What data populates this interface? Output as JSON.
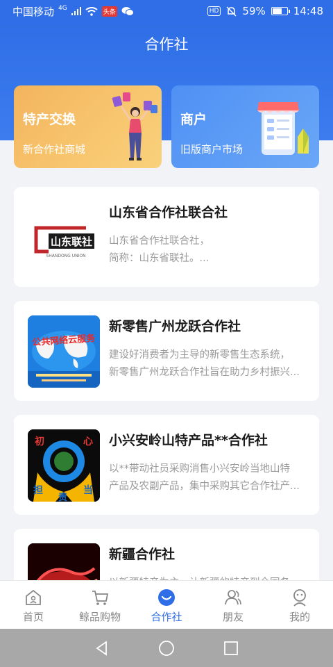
{
  "status_bar": {
    "carrier": "中国移动",
    "network": "4G",
    "badge": "头条",
    "battery": "59%",
    "battery_level": 0.59,
    "time": "14:48"
  },
  "header": {
    "title": "合作社"
  },
  "promo_cards": [
    {
      "title": "特产交换",
      "subtitle": "新合作社商城"
    },
    {
      "title": "商户",
      "subtitle": "旧版商户市场"
    }
  ],
  "coops": [
    {
      "name": "山东省合作社联合社",
      "desc": [
        "山东省合作社联合社，",
        "简称：山东省联社。..."
      ],
      "logo_text": "山东联社",
      "logo_sub": "SHANDONG UNION"
    },
    {
      "name": "新零售广州龙跃合作社",
      "desc": [
        "建设好消费者为主导的新零售生态系统，",
        "新零售广州龙跃合作社旨在助力乡村振兴..."
      ],
      "logo_text": "公共网络云服务"
    },
    {
      "name": "小兴安岭山特产品**合作社",
      "desc": [
        "以**带动社员采购消售小兴安岭当地山特",
        "产品及农副产品，集中采购其它合作社产..."
      ],
      "logo_chars": [
        "初",
        "心",
        "担",
        "责",
        "当"
      ]
    },
    {
      "name": "新疆合作社",
      "desc": [
        "以新疆特产为主，让新疆的特产到全国各..."
      ]
    }
  ],
  "tabs": [
    {
      "label": "首页",
      "icon": "home-icon"
    },
    {
      "label": "鲸品购物",
      "icon": "cart-icon"
    },
    {
      "label": "合作社",
      "icon": "coop-icon"
    },
    {
      "label": "朋友",
      "icon": "friends-icon"
    },
    {
      "label": "我的",
      "icon": "profile-icon"
    }
  ],
  "colors": {
    "primary": "#2f6ee6",
    "orange_card": "#f3b45e",
    "blue_card": "#4f90f4"
  }
}
